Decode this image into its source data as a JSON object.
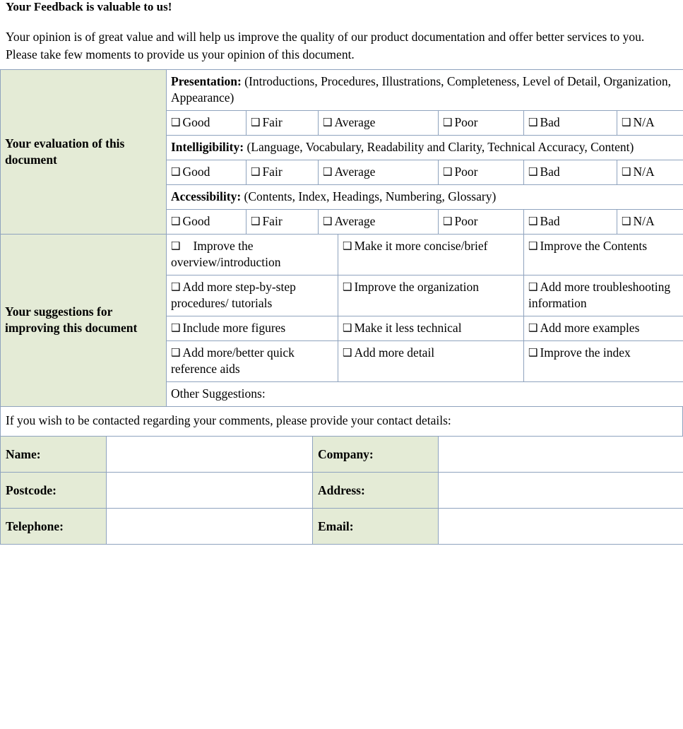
{
  "heading": "Your Feedback is valuable to us!",
  "intro": "Your opinion is of great value and will help us improve the quality of our product documentation and offer better services to you. Please take few moments to provide us your opinion of this document.",
  "colors": {
    "label_cell_background": "#E4EBD6",
    "table_border": "#8FA3BE",
    "page_background": "#FFFFFF",
    "text": "#000000"
  },
  "icons": {
    "checkbox": "❑"
  },
  "evaluation": {
    "label": "Your evaluation of this document",
    "criteria": [
      {
        "name": "Presentation:",
        "detail": "(Introductions, Procedures, Illustrations, Completeness, Level of Detail, Organization, Appearance)",
        "ratings": [
          "Good",
          "Fair",
          "Average",
          "Poor",
          "Bad",
          "N/A"
        ]
      },
      {
        "name": "Intelligibility:",
        "detail": "(Language, Vocabulary, Readability and Clarity, Technical Accuracy, Content)",
        "ratings": [
          "Good",
          "Fair",
          "Average",
          "Poor",
          "Bad",
          "N/A"
        ]
      },
      {
        "name": "Accessibility:",
        "detail": "(Contents, Index, Headings, Numbering, Glossary)",
        "ratings": [
          "Good",
          "Fair",
          "Average",
          "Poor",
          "Bad",
          "N/A"
        ]
      }
    ]
  },
  "suggestions": {
    "label": "Your suggestions for improving this document",
    "rows": [
      [
        "Improve the overview/introduction",
        "Make it more concise/brief",
        "Improve the Contents"
      ],
      [
        "Add more step-by-step procedures/ tutorials",
        "Improve the organization",
        "Add more troubleshooting information"
      ],
      [
        "Include more figures",
        "Make it less technical",
        "Add more examples"
      ],
      [
        "Add more/better quick reference aids",
        "Add more detail",
        "Improve the index"
      ]
    ],
    "other_label": "Other Suggestions:"
  },
  "contact": {
    "note": "If you wish to be contacted regarding your comments, please provide your contact details:",
    "fields": [
      {
        "left_label": "Name:",
        "left_value": "",
        "right_label": "Company:",
        "right_value": ""
      },
      {
        "left_label": "Postcode:",
        "left_value": "",
        "right_label": "Address:",
        "right_value": ""
      },
      {
        "left_label": "Telephone:",
        "left_value": "",
        "right_label": "Email:",
        "right_value": ""
      }
    ]
  }
}
